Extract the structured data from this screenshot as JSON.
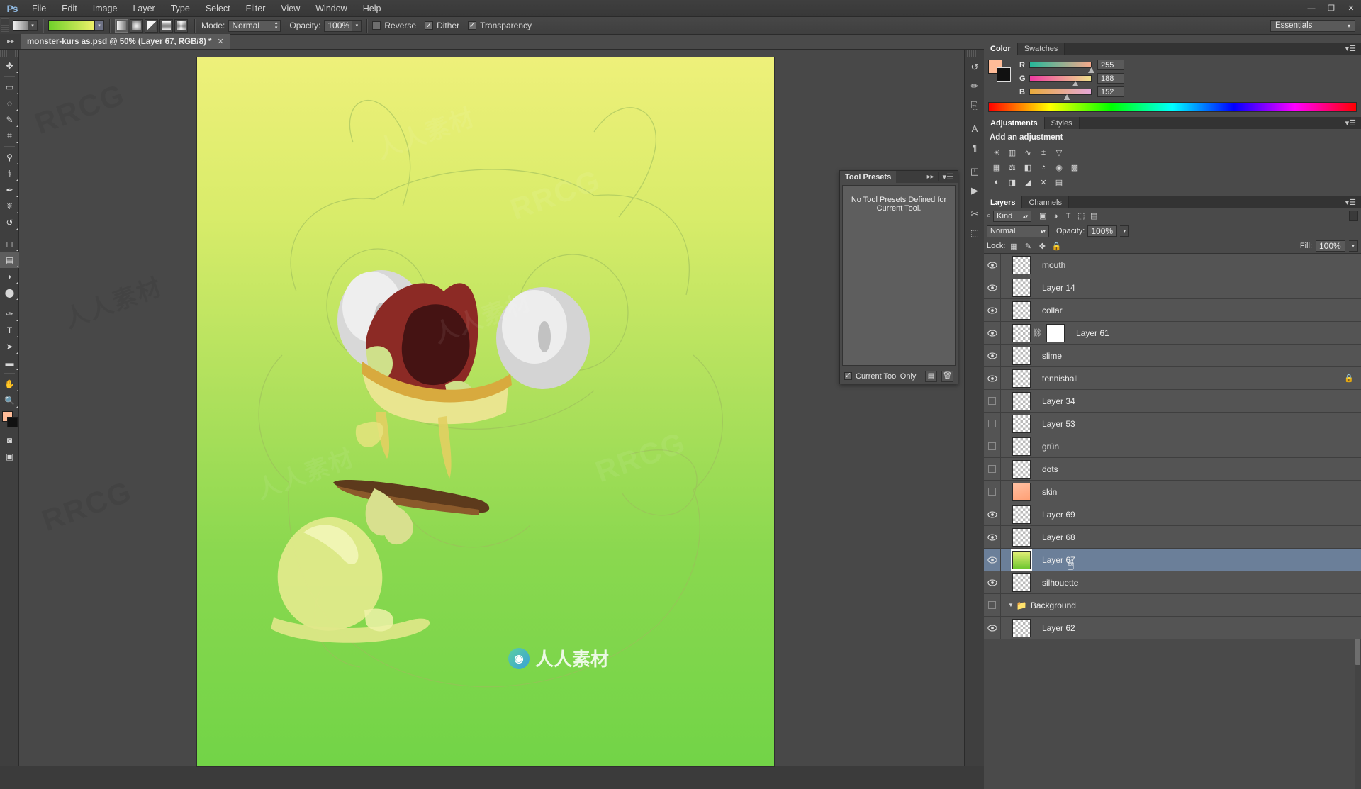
{
  "app": {
    "logo": "Ps"
  },
  "menubar": {
    "items": [
      "File",
      "Edit",
      "Image",
      "Layer",
      "Type",
      "Select",
      "Filter",
      "View",
      "Window",
      "Help"
    ],
    "window_buttons": [
      {
        "name": "minimize",
        "glyph": "—"
      },
      {
        "name": "restore",
        "glyph": "❐"
      },
      {
        "name": "close",
        "glyph": "✕"
      }
    ]
  },
  "options_bar": {
    "mode_label": "Mode:",
    "mode_value": "Normal",
    "opacity_label": "Opacity:",
    "opacity_value": "100%",
    "reverse_label": "Reverse",
    "reverse_checked": false,
    "dither_label": "Dither",
    "dither_checked": true,
    "transparency_label": "Transparency",
    "transparency_checked": true,
    "workspace": "Essentials",
    "gradient_types": [
      "linear-gradient",
      "radial-gradient",
      "angle-gradient",
      "reflected-gradient",
      "diamond-gradient"
    ]
  },
  "document_tab": {
    "title": "monster-kurs as.psd @ 50% (Layer 67, RGB/8) *",
    "close_glyph": "✕"
  },
  "toolbar": {
    "tools": [
      {
        "name": "move-tool",
        "glyph": "✥"
      },
      {
        "name": "rectangular-marquee-tool",
        "glyph": "▭"
      },
      {
        "name": "lasso-tool",
        "glyph": "◌"
      },
      {
        "name": "quick-selection-tool",
        "glyph": "✎"
      },
      {
        "name": "crop-tool",
        "glyph": "⌗"
      },
      {
        "name": "eyedropper-tool",
        "glyph": "⚲"
      },
      {
        "name": "spot-healing-brush-tool",
        "glyph": "⚕"
      },
      {
        "name": "brush-tool",
        "glyph": "✒"
      },
      {
        "name": "clone-stamp-tool",
        "glyph": "⎈"
      },
      {
        "name": "history-brush-tool",
        "glyph": "↺"
      },
      {
        "name": "eraser-tool",
        "glyph": "◻"
      },
      {
        "name": "gradient-tool",
        "glyph": "▤"
      },
      {
        "name": "blur-tool",
        "glyph": "◗"
      },
      {
        "name": "dodge-tool",
        "glyph": "⬤"
      },
      {
        "name": "pen-tool",
        "glyph": "✑"
      },
      {
        "name": "horizontal-type-tool",
        "glyph": "T"
      },
      {
        "name": "path-selection-tool",
        "glyph": "➤"
      },
      {
        "name": "rectangle-tool",
        "glyph": "▬"
      },
      {
        "name": "hand-tool",
        "glyph": "✋"
      },
      {
        "name": "zoom-tool",
        "glyph": "🔍"
      }
    ],
    "foreground_color": "#ffbc98",
    "background_color": "#111111",
    "bottom_tools": [
      {
        "name": "quick-mask-toggle",
        "glyph": "◙"
      },
      {
        "name": "screen-mode-toggle",
        "glyph": "▣"
      }
    ]
  },
  "tool_presets_panel": {
    "tab_label": "Tool Presets",
    "empty_message": "No Tool Presets Defined for Current Tool.",
    "current_tool_only_label": "Current Tool Only",
    "current_tool_only_checked": true,
    "new_preset_glyph": "▤",
    "delete_preset_glyph": "🗑"
  },
  "icon_dock": {
    "buttons": [
      {
        "name": "history-panel-icon",
        "glyph": "↺"
      },
      {
        "name": "brush-panel-icon",
        "glyph": "✏"
      },
      {
        "name": "clone-source-panel-icon",
        "glyph": "⎘"
      },
      {
        "name": "character-panel-icon",
        "glyph": "A"
      },
      {
        "name": "paragraph-panel-icon",
        "glyph": "¶"
      },
      {
        "name": "navigator-panel-icon",
        "glyph": "◰"
      },
      {
        "name": "actions-panel-icon",
        "glyph": "▶"
      },
      {
        "name": "timeline-panel-icon",
        "glyph": "✂"
      },
      {
        "name": "properties-panel-icon",
        "glyph": "⬚"
      }
    ]
  },
  "color_panel": {
    "tabs": [
      {
        "name": "tab-color",
        "label": "Color",
        "active": true
      },
      {
        "name": "tab-swatches",
        "label": "Swatches",
        "active": false
      }
    ],
    "foreground_color": "#ffbc98",
    "background_color": "#111111",
    "channels": [
      {
        "label": "R",
        "value": "255",
        "pos": 100
      },
      {
        "label": "G",
        "value": "188",
        "pos": 74
      },
      {
        "label": "B",
        "value": "152",
        "pos": 60
      }
    ]
  },
  "adjustments_panel": {
    "tabs": [
      {
        "name": "tab-adjustments",
        "label": "Adjustments",
        "active": true
      },
      {
        "name": "tab-styles",
        "label": "Styles",
        "active": false
      }
    ],
    "title": "Add an adjustment",
    "rows": [
      [
        {
          "name": "brightness-contrast-icon",
          "glyph": "☀"
        },
        {
          "name": "levels-icon",
          "glyph": "▥"
        },
        {
          "name": "curves-icon",
          "glyph": "∿"
        },
        {
          "name": "exposure-icon",
          "glyph": "±"
        },
        {
          "name": "vibrance-icon",
          "glyph": "▽"
        }
      ],
      [
        {
          "name": "hue-saturation-icon",
          "glyph": "▦"
        },
        {
          "name": "color-balance-icon",
          "glyph": "⚖"
        },
        {
          "name": "black-white-icon",
          "glyph": "◧"
        },
        {
          "name": "photo-filter-icon",
          "glyph": "◔"
        },
        {
          "name": "channel-mixer-icon",
          "glyph": "◉"
        },
        {
          "name": "color-lookup-icon",
          "glyph": "▩"
        }
      ],
      [
        {
          "name": "invert-icon",
          "glyph": "◐"
        },
        {
          "name": "posterize-icon",
          "glyph": "◨"
        },
        {
          "name": "threshold-icon",
          "glyph": "◢"
        },
        {
          "name": "selective-color-icon",
          "glyph": "✕"
        },
        {
          "name": "gradient-map-icon",
          "glyph": "▤"
        }
      ]
    ]
  },
  "layers_panel": {
    "tabs": [
      {
        "name": "tab-layers",
        "label": "Layers",
        "active": true
      },
      {
        "name": "tab-channels",
        "label": "Channels",
        "active": false
      }
    ],
    "filter_kind_label": "Kind",
    "filter_icons": [
      {
        "name": "filter-pixel-icon",
        "glyph": "▣"
      },
      {
        "name": "filter-adjustment-icon",
        "glyph": "◑"
      },
      {
        "name": "filter-type-icon",
        "glyph": "T"
      },
      {
        "name": "filter-shape-icon",
        "glyph": "⬚"
      },
      {
        "name": "filter-smart-object-icon",
        "glyph": "▤"
      }
    ],
    "blend_mode": "Normal",
    "opacity_label": "Opacity:",
    "opacity_value": "100%",
    "lock_label": "Lock:",
    "lock_icons": [
      {
        "name": "lock-transparent-pixels-icon",
        "glyph": "▦"
      },
      {
        "name": "lock-image-pixels-icon",
        "glyph": "✎"
      },
      {
        "name": "lock-position-icon",
        "glyph": "✥"
      },
      {
        "name": "lock-all-icon",
        "glyph": "🔒"
      }
    ],
    "fill_label": "Fill:",
    "fill_value": "100%",
    "layers": [
      {
        "name": "mouth",
        "visible": true,
        "selected": false,
        "thumb": "transparent",
        "locked": false
      },
      {
        "name": "Layer 14",
        "visible": true,
        "selected": false,
        "thumb": "transparent",
        "locked": false
      },
      {
        "name": "collar",
        "visible": true,
        "selected": false,
        "thumb": "transparent",
        "locked": false
      },
      {
        "name": "Layer 61",
        "visible": true,
        "selected": false,
        "thumb": "transparent",
        "locked": false,
        "has_mask": true
      },
      {
        "name": "slime",
        "visible": true,
        "selected": false,
        "thumb": "transparent",
        "locked": false
      },
      {
        "name": "tennisball",
        "visible": true,
        "selected": false,
        "thumb": "transparent",
        "locked": true
      },
      {
        "name": "Layer 34",
        "visible": false,
        "selected": false,
        "thumb": "transparent",
        "locked": false
      },
      {
        "name": "Layer 53",
        "visible": false,
        "selected": false,
        "thumb": "transparent",
        "locked": false
      },
      {
        "name": "grün",
        "visible": false,
        "selected": false,
        "thumb": "transparent",
        "locked": false
      },
      {
        "name": "dots",
        "visible": false,
        "selected": false,
        "thumb": "transparent",
        "locked": false
      },
      {
        "name": "skin",
        "visible": false,
        "selected": false,
        "thumb": "skin",
        "locked": false
      },
      {
        "name": "Layer 69",
        "visible": true,
        "selected": false,
        "thumb": "transparent",
        "locked": false
      },
      {
        "name": "Layer 68",
        "visible": true,
        "selected": false,
        "thumb": "transparent",
        "locked": false
      },
      {
        "name": "Layer 67",
        "visible": true,
        "selected": true,
        "thumb": "green-gradient",
        "locked": false
      },
      {
        "name": "silhouette",
        "visible": true,
        "selected": false,
        "thumb": "silhouette",
        "locked": false
      },
      {
        "name": "Background",
        "visible": false,
        "selected": false,
        "thumb": "folder",
        "locked": false,
        "is_group": true
      },
      {
        "name": "Layer 62",
        "visible": true,
        "selected": false,
        "thumb": "transparent",
        "locked": false
      }
    ]
  },
  "watermarks": {
    "text": "RRCG",
    "cn_text": "人人素材",
    "center_label": "人人素材"
  }
}
